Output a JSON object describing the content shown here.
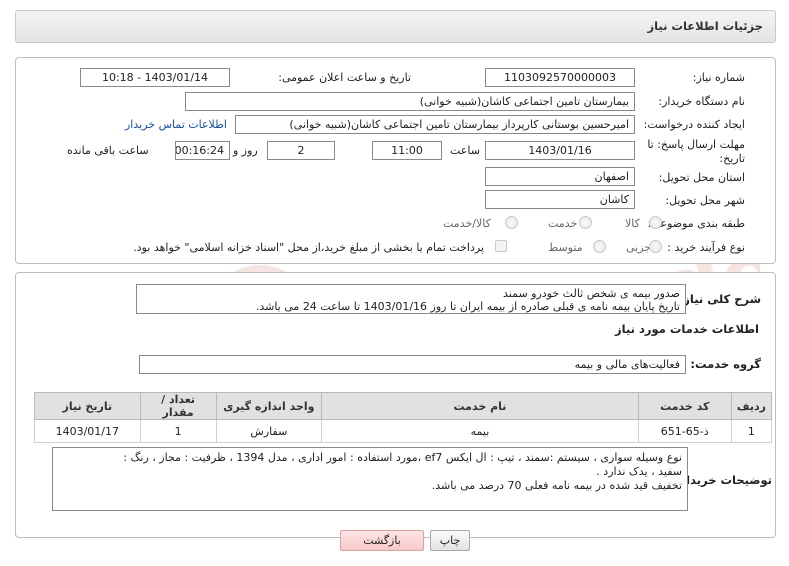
{
  "header": {
    "title": "جزئیات اطلاعات نیاز"
  },
  "form": {
    "need_number": {
      "label": "شماره نیاز:",
      "value": "1103092570000003"
    },
    "announce_datetime": {
      "label": "تاریخ و ساعت اعلان عمومی:",
      "value": "1403/01/14 - 10:18"
    },
    "buyer_org": {
      "label": "نام دستگاه خریدار:",
      "value": "بیمارستان تامین اجتماعی کاشان(شبیه خوانی)"
    },
    "requester": {
      "label": "ایجاد کننده درخواست:",
      "value": "امیرحسین بوستانی کارپرداز بیمارستان تامین اجتماعی کاشان(شبیه خوانی)",
      "contact_link": "اطلاعات تماس خریدار"
    },
    "deadline": {
      "label": "مهلت ارسال پاسخ: تا تاریخ:",
      "date": "1403/01/16",
      "time_label": "ساعت",
      "time": "11:00",
      "days": "2",
      "days_label": "روز و",
      "remaining": "00:16:24",
      "remaining_label": "ساعت باقی مانده"
    },
    "province": {
      "label": "استان محل تحویل:",
      "value": "اصفهان"
    },
    "city": {
      "label": "شهر محل تحویل:",
      "value": "کاشان"
    },
    "category": {
      "label": "طبقه بندی موضوعی:",
      "options": [
        "کالا",
        "خدمت",
        "کالا/خدمت"
      ]
    },
    "process_type": {
      "label": "نوع فرآیند خرید :",
      "options": [
        "جزیی",
        "متوسط"
      ],
      "payment_note": "پرداخت تمام یا بخشی از مبلغ خرید،از محل \"اسناد خزانه اسلامی\" خواهد بود."
    }
  },
  "description": {
    "label": "شرح کلی نیاز:",
    "line1": "صدور بیمه ی شخص ثالث خودرو سمند",
    "line2": "تاریخ پایان بیمه نامه ی قبلی صادره از بیمه ایران تا روز 1403/01/16 تا ساعت 24 می باشد."
  },
  "services": {
    "section_title": "اطلاعات خدمات مورد نیاز",
    "group_label": "گروه خدمت:",
    "group_value": "فعالیت‌های مالی و بیمه",
    "columns": [
      "ردیف",
      "کد خدمت",
      "نام خدمت",
      "واحد اندازه گیری",
      "تعداد / مقدار",
      "تاریخ نیاز"
    ],
    "rows": [
      [
        "1",
        "ذ-65-651",
        "بیمه",
        "سفارش",
        "1",
        "1403/01/17"
      ]
    ]
  },
  "buyer_notes": {
    "label": "توضیحات خریدار:",
    "line1": "نوع وسیله سواری ، سیستم :سمند ، تیپ : ال ایکس ef7 ،مورد استفاده : امور اداری ، مدل 1394 ، ظرفیت : مجاز  ، رنگ :",
    "line2": "سفید ، یدک ندارد .",
    "line3": "تخفیف قید شده در بیمه نامه فعلی 70 درصد می باشد."
  },
  "buttons": {
    "print": "چاپ",
    "back": "بازگشت"
  },
  "watermark": {
    "text": "AriaTender.net"
  },
  "colors": {
    "link": "#1a4fa3",
    "back_button": "#f7c9c9",
    "table_header": "#e1e1e1"
  }
}
